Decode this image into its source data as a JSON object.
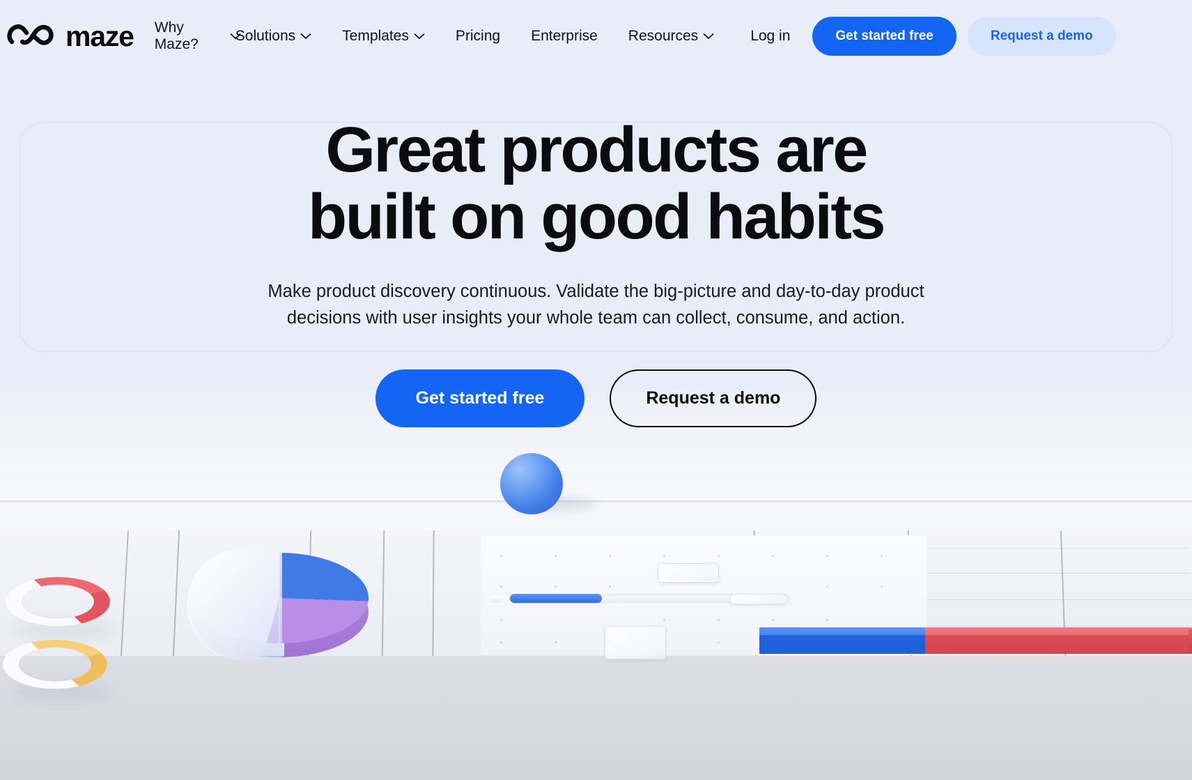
{
  "brand": {
    "name": "maze",
    "logo_icon": "maze-infinity-logo-icon"
  },
  "nav": {
    "items": [
      {
        "label": "Why Maze?",
        "has_dropdown": true,
        "icon": "chevron-down-icon"
      },
      {
        "label": "Solutions",
        "has_dropdown": true,
        "icon": "chevron-down-icon"
      },
      {
        "label": "Templates",
        "has_dropdown": true,
        "icon": "chevron-down-icon"
      },
      {
        "label": "Pricing",
        "has_dropdown": false,
        "icon": ""
      },
      {
        "label": "Enterprise",
        "has_dropdown": false,
        "icon": ""
      },
      {
        "label": "Resources",
        "has_dropdown": true,
        "icon": "chevron-down-icon"
      }
    ],
    "login_label": "Log in",
    "primary_cta": "Get started free",
    "secondary_cta": "Request a demo"
  },
  "hero": {
    "headline_line1": "Great products are",
    "headline_line2": "built on good habits",
    "subheadline": "Make product discovery continuous. Validate the big-picture and day-to-day product decisions with user insights your whole team can collect, consume, and action.",
    "primary_cta": "Get started free",
    "secondary_cta": "Request a demo"
  },
  "illustration": {
    "description": "3D rendered analytics dashboard scene on a white desk",
    "objects": [
      {
        "name": "donut-chart-red",
        "color": "#e8656b"
      },
      {
        "name": "donut-chart-yellow",
        "color": "#f6cf7c"
      },
      {
        "name": "pie-chart-3d",
        "segments": [
          {
            "label": "blue",
            "color": "#3f7ae6",
            "share": 26
          },
          {
            "label": "purple",
            "color": "#b98ee6",
            "share": 29
          },
          {
            "label": "white",
            "color": "#f2f4f9",
            "share": 45
          }
        ]
      },
      {
        "name": "sphere-blue",
        "color": "#4f86ec"
      },
      {
        "name": "slider-control",
        "fill_color": "#2f6ddf",
        "progress": 33
      },
      {
        "name": "stacked-bar",
        "segments": [
          {
            "label": "blue",
            "color": "#1f63de"
          },
          {
            "label": "red",
            "color": "#dc4b54"
          }
        ]
      }
    ]
  },
  "colors": {
    "background": "#e9edf8",
    "brand_blue": "#1565f5",
    "soft_blue": "#d7e4fe",
    "ink": "#0b0b10"
  }
}
